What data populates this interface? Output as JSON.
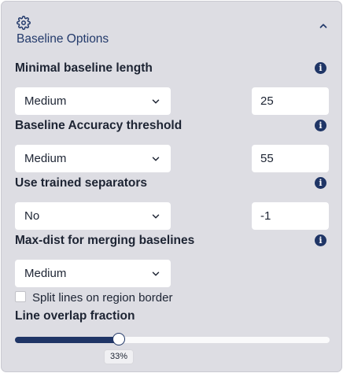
{
  "panel": {
    "title": "Baseline Options",
    "icon": "gear-icon",
    "collapse_icon": "chevron-up-icon"
  },
  "fields": {
    "min_length": {
      "label": "Minimal baseline length",
      "select_value": "Medium",
      "number_value": "25"
    },
    "accuracy": {
      "label": "Baseline Accuracy threshold",
      "select_value": "Medium",
      "number_value": "55"
    },
    "separators": {
      "label": "Use trained separators",
      "select_value": "No",
      "number_value": "-1"
    },
    "max_dist": {
      "label": "Max-dist for merging baselines",
      "select_value": "Medium"
    }
  },
  "split_lines": {
    "label": "Split lines on region border",
    "checked": false
  },
  "overlap": {
    "label": "Line overlap fraction",
    "value_text": "33%",
    "value": 0.33
  },
  "colors": {
    "accent": "#1f3566",
    "panel_bg": "#dddde3",
    "title": "#233a6b"
  }
}
